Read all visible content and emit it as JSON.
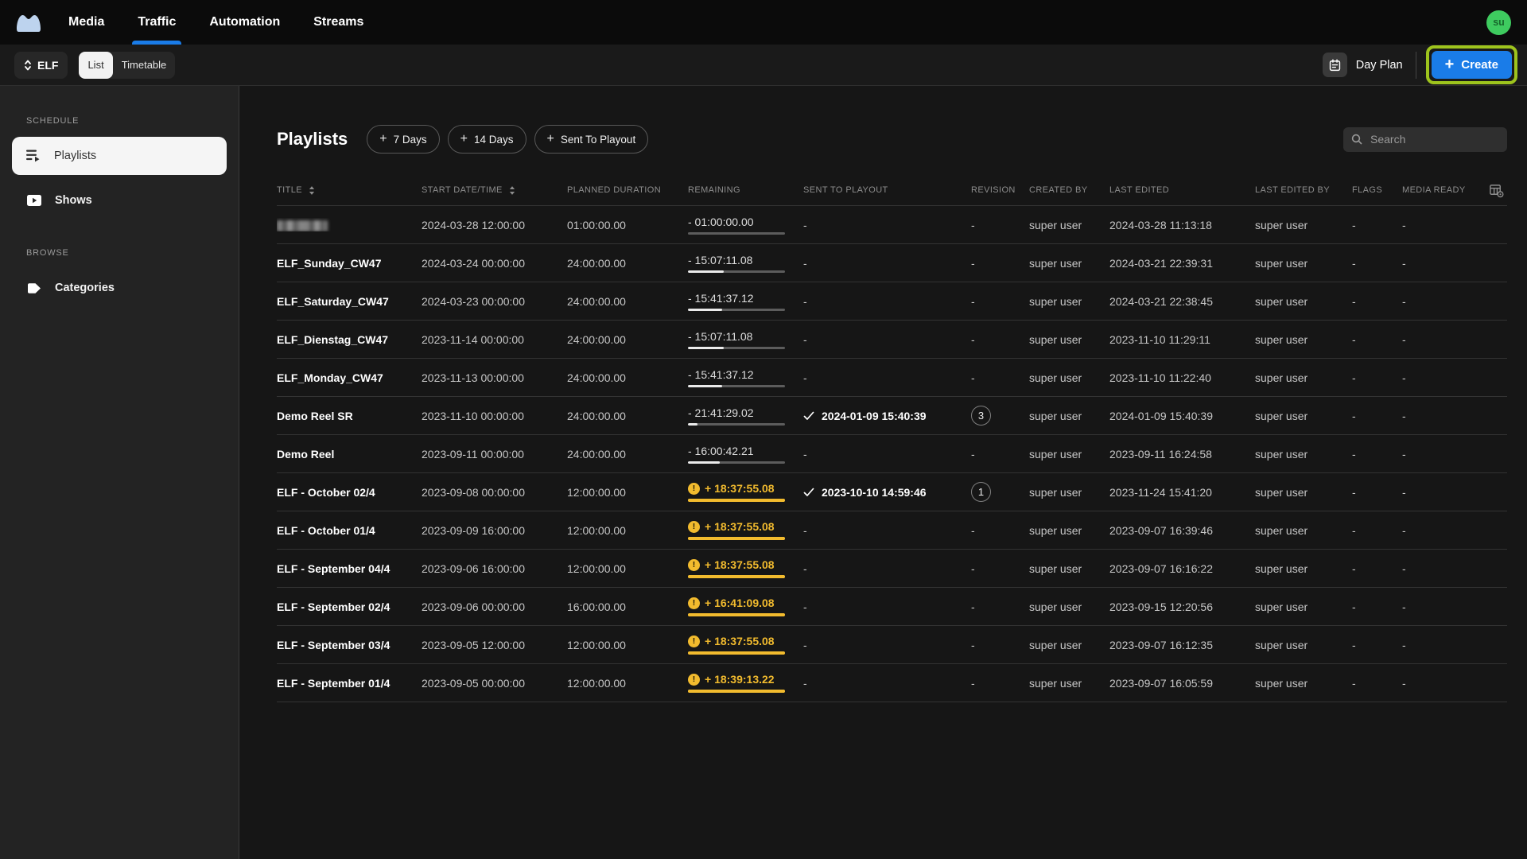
{
  "nav": {
    "items": [
      {
        "label": "Media",
        "active": false
      },
      {
        "label": "Traffic",
        "active": true
      },
      {
        "label": "Automation",
        "active": false
      },
      {
        "label": "Streams",
        "active": false
      }
    ],
    "avatar_initials": "su"
  },
  "toolbar": {
    "channel_label": "ELF",
    "views": [
      "List",
      "Timetable"
    ],
    "view_selected": "List",
    "day_plan_label": "Day Plan",
    "create_label": "Create"
  },
  "sidebar": {
    "sections": [
      {
        "label": "SCHEDULE",
        "items": [
          {
            "label": "Playlists",
            "icon": "playlist-icon",
            "active": true
          },
          {
            "label": "Shows",
            "icon": "show-icon",
            "active": false
          }
        ]
      },
      {
        "label": "BROWSE",
        "items": [
          {
            "label": "Categories",
            "icon": "tag-icon",
            "active": false
          }
        ]
      }
    ]
  },
  "main": {
    "title": "Playlists",
    "quick_filters": [
      "7 Days",
      "14 Days",
      "Sent To Playout"
    ],
    "search_placeholder": "Search",
    "table": {
      "columns": [
        {
          "label": "TITLE",
          "sortable": true
        },
        {
          "label": "START DATE/TIME",
          "sortable": true
        },
        {
          "label": "PLANNED DURATION",
          "sortable": false
        },
        {
          "label": "REMAINING",
          "sortable": false
        },
        {
          "label": "SENT TO PLAYOUT",
          "sortable": false
        },
        {
          "label": "REVISION",
          "sortable": false
        },
        {
          "label": "CREATED BY",
          "sortable": false
        },
        {
          "label": "LAST EDITED",
          "sortable": false
        },
        {
          "label": "LAST EDITED BY",
          "sortable": false
        },
        {
          "label": "FLAGS",
          "sortable": false
        },
        {
          "label": "MEDIA READY",
          "sortable": false
        }
      ],
      "rows": [
        {
          "redacted": true,
          "title": "",
          "start": "2024-03-28 12:00:00",
          "planned": "01:00:00.00",
          "remaining_text": "- 01:00:00.00",
          "remaining_state": "normal",
          "progress": 0,
          "sent_checked": false,
          "sent_text": "-",
          "revision": "-",
          "created_by": "super user",
          "last_edited": "2024-03-28 11:13:18",
          "last_edited_by": "super user",
          "flags": "-",
          "media_ready": "-"
        },
        {
          "redacted": false,
          "title": "ELF_Sunday_CW47",
          "start": "2024-03-24 00:00:00",
          "planned": "24:00:00.00",
          "remaining_text": "- 15:07:11.08",
          "remaining_state": "normal",
          "progress": 0.37,
          "sent_checked": false,
          "sent_text": "-",
          "revision": "-",
          "created_by": "super user",
          "last_edited": "2024-03-21 22:39:31",
          "last_edited_by": "super user",
          "flags": "-",
          "media_ready": "-"
        },
        {
          "redacted": false,
          "title": "ELF_Saturday_CW47",
          "start": "2024-03-23 00:00:00",
          "planned": "24:00:00.00",
          "remaining_text": "- 15:41:37.12",
          "remaining_state": "normal",
          "progress": 0.35,
          "sent_checked": false,
          "sent_text": "-",
          "revision": "-",
          "created_by": "super user",
          "last_edited": "2024-03-21 22:38:45",
          "last_edited_by": "super user",
          "flags": "-",
          "media_ready": "-"
        },
        {
          "redacted": false,
          "title": "ELF_Dienstag_CW47",
          "start": "2023-11-14 00:00:00",
          "planned": "24:00:00.00",
          "remaining_text": "- 15:07:11.08",
          "remaining_state": "normal",
          "progress": 0.37,
          "sent_checked": false,
          "sent_text": "-",
          "revision": "-",
          "created_by": "super user",
          "last_edited": "2023-11-10 11:29:11",
          "last_edited_by": "super user",
          "flags": "-",
          "media_ready": "-"
        },
        {
          "redacted": false,
          "title": "ELF_Monday_CW47",
          "start": "2023-11-13 00:00:00",
          "planned": "24:00:00.00",
          "remaining_text": "- 15:41:37.12",
          "remaining_state": "normal",
          "progress": 0.35,
          "sent_checked": false,
          "sent_text": "-",
          "revision": "-",
          "created_by": "super user",
          "last_edited": "2023-11-10 11:22:40",
          "last_edited_by": "super user",
          "flags": "-",
          "media_ready": "-"
        },
        {
          "redacted": false,
          "title": "Demo Reel SR",
          "start": "2023-11-10 00:00:00",
          "planned": "24:00:00.00",
          "remaining_text": "- 21:41:29.02",
          "remaining_state": "normal",
          "progress": 0.1,
          "sent_checked": true,
          "sent_text": "2024-01-09 15:40:39",
          "revision": "3",
          "created_by": "super user",
          "last_edited": "2024-01-09 15:40:39",
          "last_edited_by": "super user",
          "flags": "-",
          "media_ready": "-"
        },
        {
          "redacted": false,
          "title": "Demo Reel",
          "start": "2023-09-11 00:00:00",
          "planned": "24:00:00.00",
          "remaining_text": "- 16:00:42.21",
          "remaining_state": "normal",
          "progress": 0.33,
          "sent_checked": false,
          "sent_text": "-",
          "revision": "-",
          "created_by": "super user",
          "last_edited": "2023-09-11 16:24:58",
          "last_edited_by": "super user",
          "flags": "-",
          "media_ready": "-"
        },
        {
          "redacted": false,
          "title": "ELF - October 02/4",
          "start": "2023-09-08 00:00:00",
          "planned": "12:00:00.00",
          "remaining_text": "+ 18:37:55.08",
          "remaining_state": "overdue",
          "progress": 1,
          "sent_checked": true,
          "sent_text": "2023-10-10 14:59:46",
          "revision": "1",
          "created_by": "super user",
          "last_edited": "2023-11-24 15:41:20",
          "last_edited_by": "super user",
          "flags": "-",
          "media_ready": "-"
        },
        {
          "redacted": false,
          "title": "ELF - October 01/4",
          "start": "2023-09-09 16:00:00",
          "planned": "12:00:00.00",
          "remaining_text": "+ 18:37:55.08",
          "remaining_state": "overdue",
          "progress": 1,
          "sent_checked": false,
          "sent_text": "-",
          "revision": "-",
          "created_by": "super user",
          "last_edited": "2023-09-07 16:39:46",
          "last_edited_by": "super user",
          "flags": "-",
          "media_ready": "-"
        },
        {
          "redacted": false,
          "title": "ELF - September 04/4",
          "start": "2023-09-06 16:00:00",
          "planned": "12:00:00.00",
          "remaining_text": "+ 18:37:55.08",
          "remaining_state": "overdue",
          "progress": 1,
          "sent_checked": false,
          "sent_text": "-",
          "revision": "-",
          "created_by": "super user",
          "last_edited": "2023-09-07 16:16:22",
          "last_edited_by": "super user",
          "flags": "-",
          "media_ready": "-"
        },
        {
          "redacted": false,
          "title": "ELF - September 02/4",
          "start": "2023-09-06 00:00:00",
          "planned": "16:00:00.00",
          "remaining_text": "+ 16:41:09.08",
          "remaining_state": "overdue",
          "progress": 1,
          "sent_checked": false,
          "sent_text": "-",
          "revision": "-",
          "created_by": "super user",
          "last_edited": "2023-09-15 12:20:56",
          "last_edited_by": "super user",
          "flags": "-",
          "media_ready": "-"
        },
        {
          "redacted": false,
          "title": "ELF - September 03/4",
          "start": "2023-09-05 12:00:00",
          "planned": "12:00:00.00",
          "remaining_text": "+ 18:37:55.08",
          "remaining_state": "overdue",
          "progress": 1,
          "sent_checked": false,
          "sent_text": "-",
          "revision": "-",
          "created_by": "super user",
          "last_edited": "2023-09-07 16:12:35",
          "last_edited_by": "super user",
          "flags": "-",
          "media_ready": "-"
        },
        {
          "redacted": false,
          "title": "ELF - September 01/4",
          "start": "2023-09-05 00:00:00",
          "planned": "12:00:00.00",
          "remaining_text": "+ 18:39:13.22",
          "remaining_state": "overdue",
          "progress": 1,
          "sent_checked": false,
          "sent_text": "-",
          "revision": "-",
          "created_by": "super user",
          "last_edited": "2023-09-07 16:05:59",
          "last_edited_by": "super user",
          "flags": "-",
          "media_ready": "-"
        }
      ]
    }
  },
  "colors": {
    "accent_blue": "#1a7ce8",
    "warning_yellow": "#f2bb2e",
    "highlight_green": "#9ec41d",
    "avatar_green": "#3ecb5f"
  }
}
